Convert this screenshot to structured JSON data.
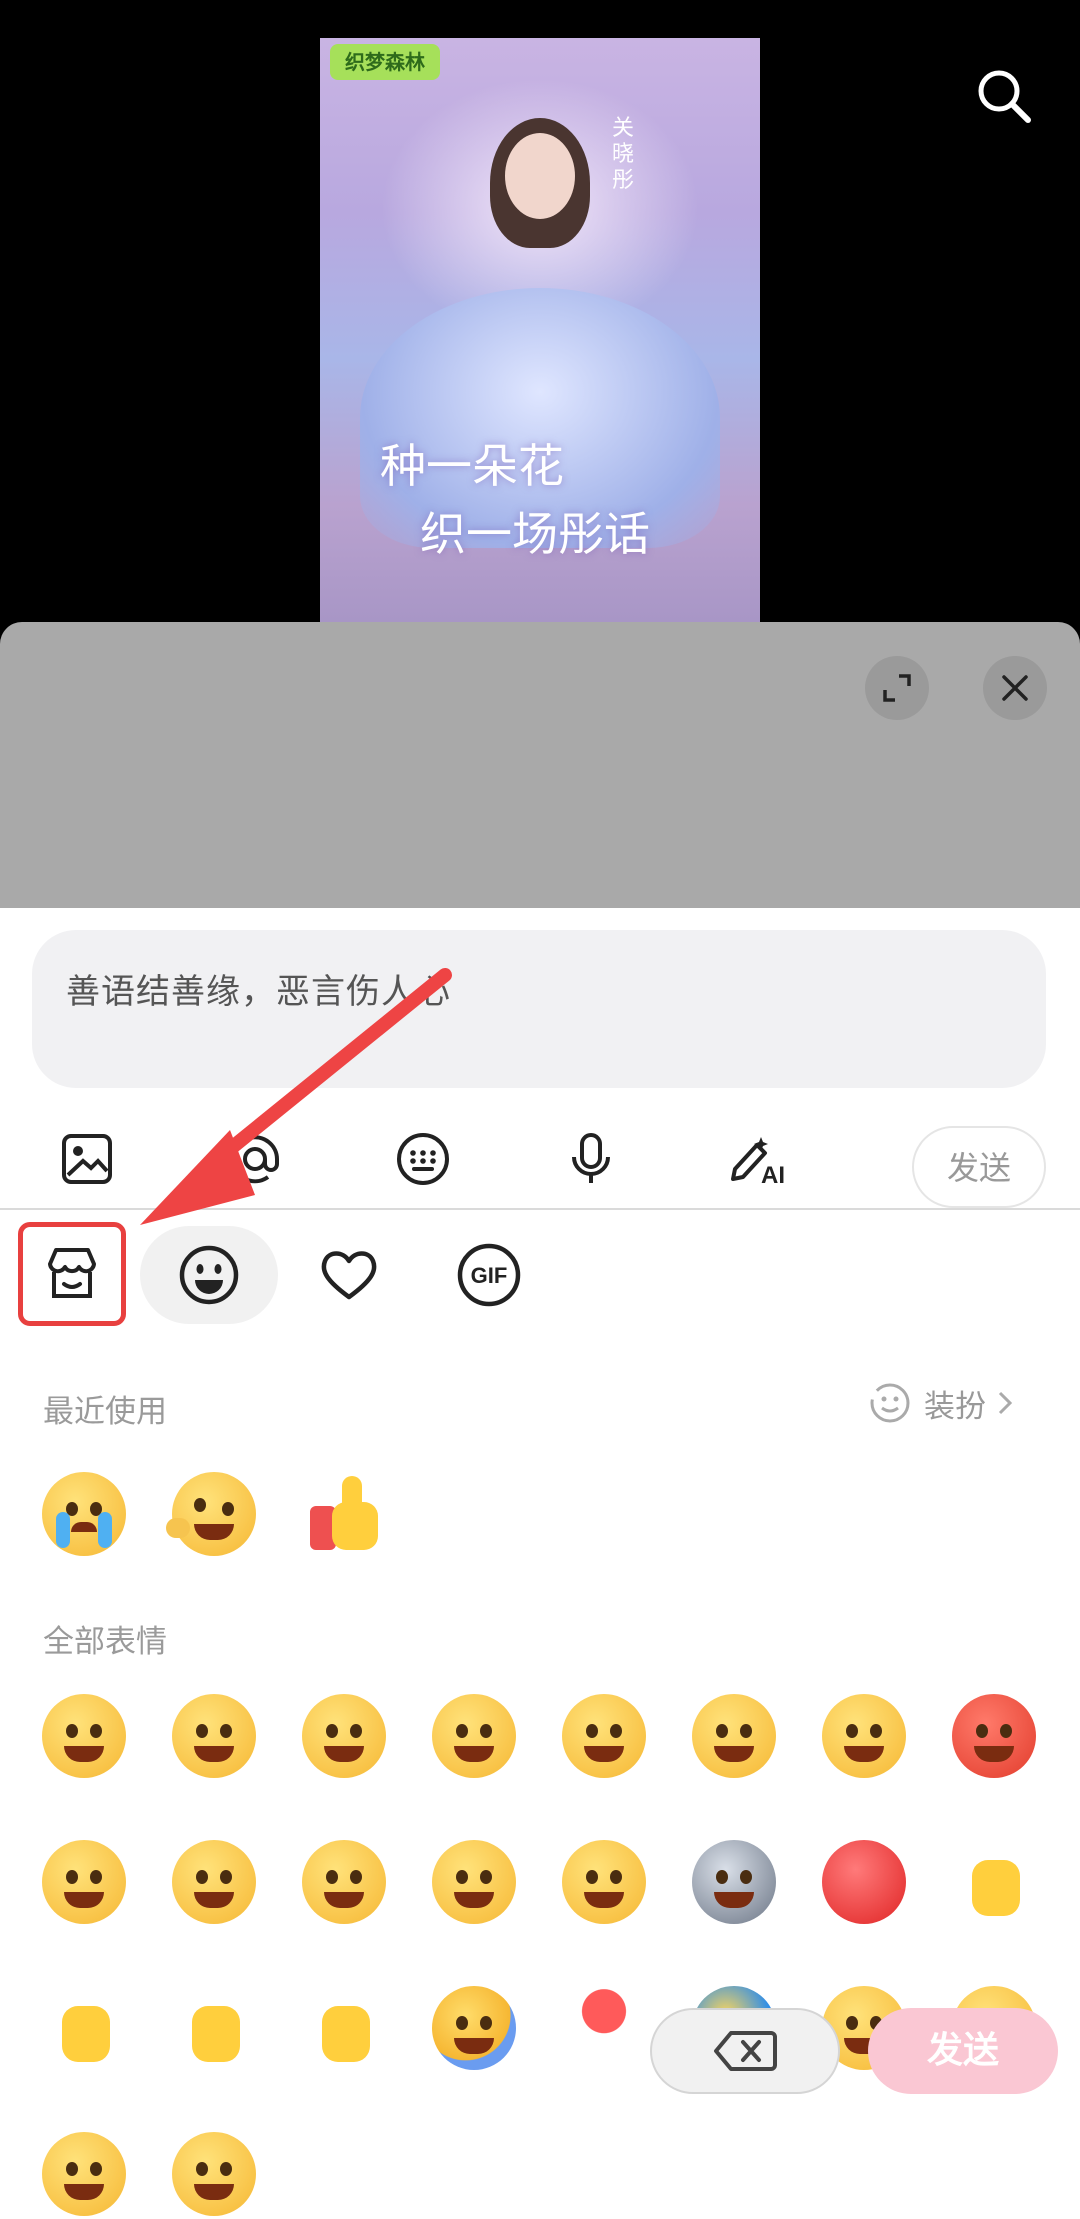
{
  "poster": {
    "logo_text": "织梦森林",
    "actress_name": "关晓彤",
    "slogan_line1": "种一朵花",
    "slogan_line2": "织一场彤话"
  },
  "comment": {
    "placeholder": "善语结善缘，恶言伤人心"
  },
  "toolbar": {
    "send_label": "发送",
    "icons": [
      "image-icon",
      "mention-icon",
      "keyboard-icon",
      "microphone-icon",
      "ai-pen-icon"
    ]
  },
  "sticker_tabs": [
    "sticker-shop-icon",
    "emoji-face-icon",
    "heart-icon",
    "gif-icon"
  ],
  "sections": {
    "recent_title": "最近使用",
    "all_title": "全部表情",
    "dressup_label": "装扮"
  },
  "recent_emojis": [
    "crying",
    "laughing-rolling",
    "thumbs-up"
  ],
  "all_emojis": [
    "smile",
    "kiss-heart-eyes",
    "shocked-sweat",
    "annoyed",
    "yawn",
    "crying",
    "laughing-tears",
    "angry",
    "grin",
    "sweat-grin",
    "content",
    "tongue-wink",
    "heart-eyes-drool",
    "husky",
    "red-heart",
    "finger-heart",
    "thumbs-up",
    "clapping",
    "pray",
    "hug",
    "rose",
    "blue-hair",
    "smirk-eyebrow",
    "pleading",
    "pressed-hands",
    "overwhelmed"
  ],
  "float_buttons": {
    "send_label": "发送"
  },
  "colors": {
    "accent_red": "#e8403f",
    "send_pink": "#fac7d3",
    "panel_bg": "#ffffff",
    "sheet_gray": "#a9a9a9"
  }
}
